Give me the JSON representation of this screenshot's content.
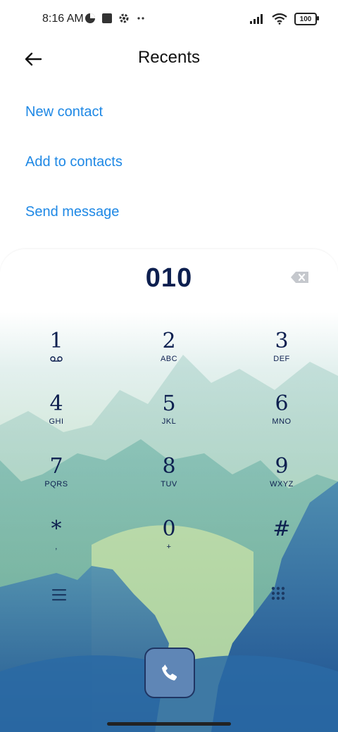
{
  "status_bar": {
    "time": "8:16 AM",
    "battery": "100",
    "icons_left": [
      "data-saver-icon",
      "square-notification-icon",
      "settings-icon",
      "more-dots-icon"
    ],
    "icons_right": [
      "signal-icon",
      "wifi-icon",
      "battery-icon"
    ]
  },
  "header": {
    "title": "Recents",
    "back_icon": "back-arrow-icon"
  },
  "actions": {
    "new_contact": "New contact",
    "add_to_contacts": "Add to contacts",
    "send_message": "Send message"
  },
  "dialer": {
    "number": "010",
    "keys": [
      {
        "digit": "1",
        "letters": ""
      },
      {
        "digit": "2",
        "letters": "ABC"
      },
      {
        "digit": "3",
        "letters": "DEF"
      },
      {
        "digit": "4",
        "letters": "GHI"
      },
      {
        "digit": "5",
        "letters": "JKL"
      },
      {
        "digit": "6",
        "letters": "MNO"
      },
      {
        "digit": "7",
        "letters": "PQRS"
      },
      {
        "digit": "8",
        "letters": "TUV"
      },
      {
        "digit": "9",
        "letters": "WXYZ"
      },
      {
        "digit": "*",
        "letters": ","
      },
      {
        "digit": "0",
        "letters": "+"
      },
      {
        "digit": "#",
        "letters": ""
      }
    ]
  },
  "colors": {
    "link": "#1e88e5",
    "dialer_text": "#0d1f4f",
    "call_button": "#5f86b6"
  }
}
